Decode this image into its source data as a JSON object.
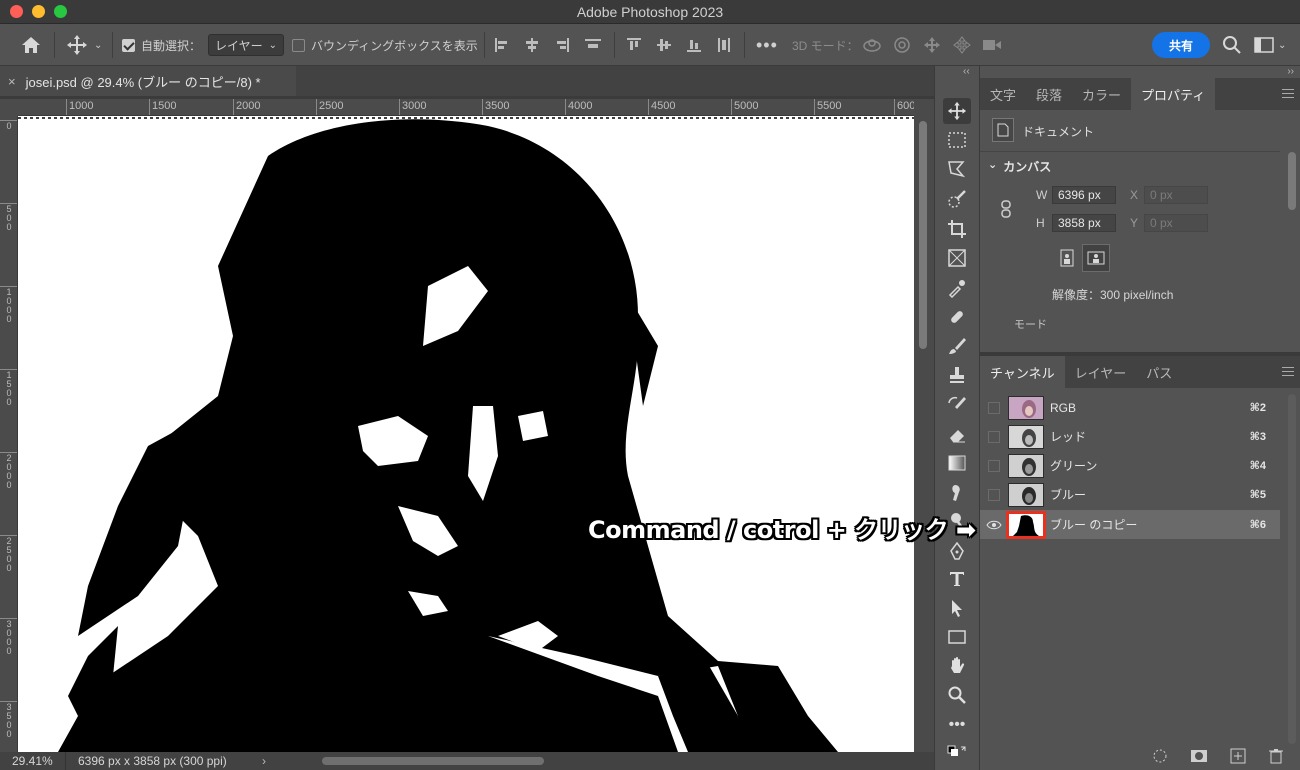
{
  "window": {
    "title": "Adobe Photoshop 2023"
  },
  "options_bar": {
    "auto_select_label": "自動選択：",
    "auto_select_value": "レイヤー",
    "bounding_box_label": "バウンディングボックスを表示",
    "mode_3d_label": "3D モード：",
    "share_label": "共有"
  },
  "document": {
    "tab_title": "josei.psd @ 29.4% (ブルー のコピー/8) *",
    "ruler_h": [
      "1000",
      "1500",
      "2000",
      "2500",
      "3000",
      "3500",
      "4000",
      "4500",
      "5000",
      "5500",
      "600"
    ],
    "ruler_v": [
      "0",
      "500",
      "1000",
      "1500",
      "2000",
      "2500",
      "3000",
      "3500"
    ],
    "zoom": "29.41%",
    "status_info": "6396 px x 3858 px (300 ppi)"
  },
  "properties_panel": {
    "tabs": [
      "文字",
      "段落",
      "カラー",
      "プロパティ"
    ],
    "active_tab": "プロパティ",
    "doc_label": "ドキュメント",
    "canvas_section": "カンバス",
    "w_label": "W",
    "w_value": "6396 px",
    "h_label": "H",
    "h_value": "3858 px",
    "x_label": "X",
    "x_placeholder": "0 px",
    "y_label": "Y",
    "y_placeholder": "0 px",
    "resolution": "解像度：300 pixel/inch",
    "mode_label": "モード"
  },
  "channels_panel": {
    "tabs": [
      "チャンネル",
      "レイヤー",
      "パス"
    ],
    "active_tab": "チャンネル",
    "rows": [
      {
        "name": "RGB",
        "shortcut": "⌘2"
      },
      {
        "name": "レッド",
        "shortcut": "⌘3"
      },
      {
        "name": "グリーン",
        "shortcut": "⌘4"
      },
      {
        "name": "ブルー",
        "shortcut": "⌘5"
      },
      {
        "name": "ブルー のコピー",
        "shortcut": "⌘6"
      }
    ],
    "selected_index": 4
  },
  "annotation": {
    "text": "Command / cotrol + クリック ➡"
  },
  "colors": {
    "accent": "#1473e6",
    "highlight_box": "#e8321f",
    "panel_bg": "#535353"
  }
}
